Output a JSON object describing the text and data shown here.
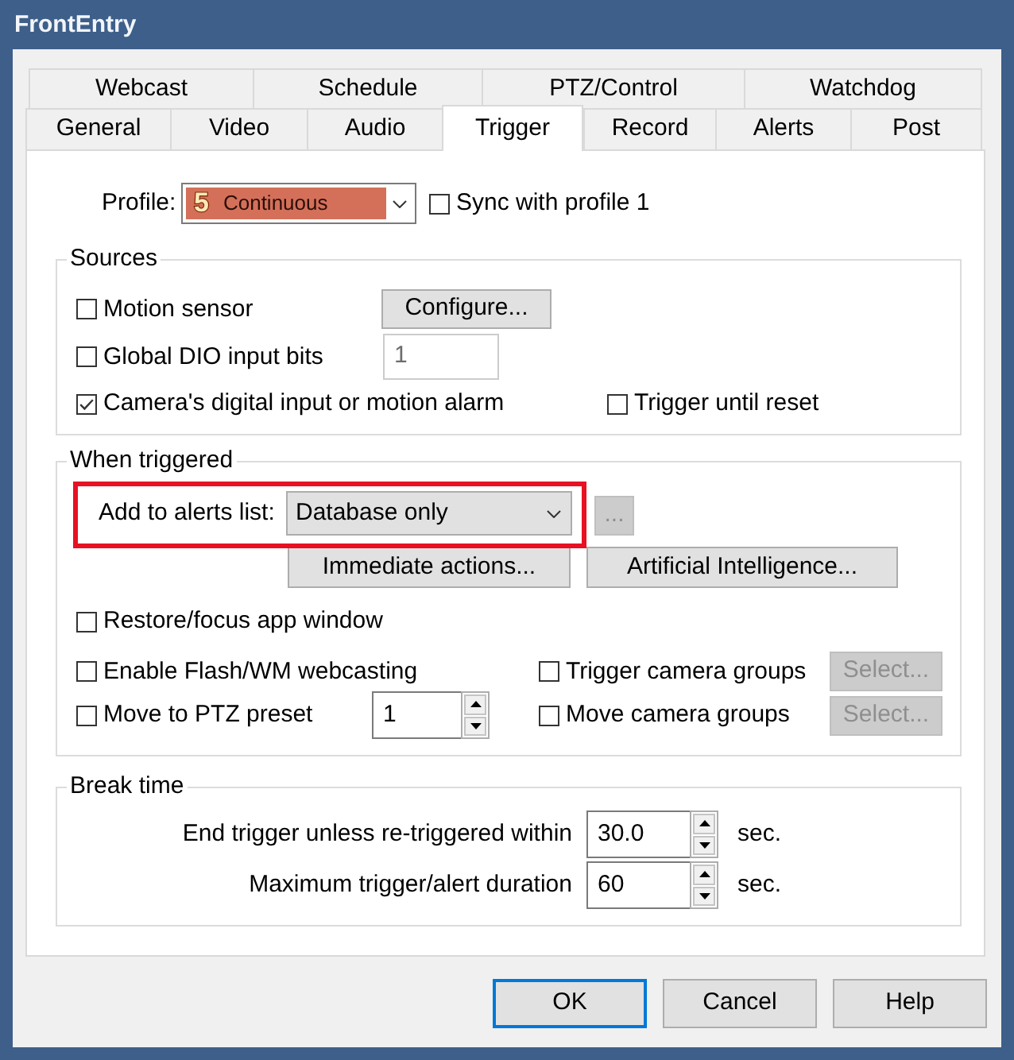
{
  "window": {
    "title": "FrontEntry"
  },
  "tab_rows": [
    [
      {
        "label": "Webcast",
        "selected": false
      },
      {
        "label": "Schedule",
        "selected": false
      },
      {
        "label": "PTZ/Control",
        "selected": false
      },
      {
        "label": "Watchdog",
        "selected": false
      }
    ],
    [
      {
        "label": "General",
        "selected": false
      },
      {
        "label": "Video",
        "selected": false
      },
      {
        "label": "Audio",
        "selected": false
      },
      {
        "label": "Trigger",
        "selected": true
      },
      {
        "label": "Record",
        "selected": false
      },
      {
        "label": "Alerts",
        "selected": false
      },
      {
        "label": "Post",
        "selected": false
      }
    ]
  ],
  "profile": {
    "label": "Profile:",
    "number": "5",
    "value": "Continuous",
    "sync": {
      "label": "Sync with profile 1",
      "checked": false
    }
  },
  "sources": {
    "title": "Sources",
    "motion_sensor": {
      "label": "Motion sensor",
      "checked": false,
      "button": {
        "label": "Configure...",
        "disabled": false
      }
    },
    "dio_bits": {
      "label": "Global DIO input bits",
      "checked": false,
      "value": "1",
      "disabled": true
    },
    "camera_input": {
      "label": "Camera's digital input or motion alarm",
      "checked": true
    },
    "trigger_until_reset": {
      "label": "Trigger until reset",
      "checked": false
    }
  },
  "when_triggered": {
    "title": "When triggered",
    "alerts_list": {
      "label": "Add to alerts list:",
      "value": "Database only",
      "highlighted": true,
      "more_button": {
        "label": "...",
        "disabled": true
      }
    },
    "action_buttons": [
      {
        "label": "Immediate actions...",
        "disabled": false
      },
      {
        "label": "Artificial Intelligence...",
        "disabled": false
      }
    ],
    "restore_focus": {
      "label": "Restore/focus app window",
      "checked": false
    },
    "webcasting": {
      "label": "Enable Flash/WM webcasting",
      "checked": false
    },
    "ptz_preset": {
      "label": "Move to PTZ preset",
      "checked": false,
      "value": "1"
    },
    "trigger_groups": {
      "label": "Trigger camera groups",
      "checked": false,
      "button": {
        "label": "Select...",
        "disabled": true
      }
    },
    "move_groups": {
      "label": "Move camera groups",
      "checked": false,
      "button": {
        "label": "Select...",
        "disabled": true
      }
    }
  },
  "break_time": {
    "title": "Break time",
    "rows": [
      {
        "label": "End trigger unless re-triggered within",
        "value": "30.0",
        "unit": "sec."
      },
      {
        "label": "Maximum trigger/alert duration",
        "value": "60",
        "unit": "sec."
      }
    ]
  },
  "buttons": [
    {
      "label": "OK",
      "default": true
    },
    {
      "label": "Cancel",
      "default": false
    },
    {
      "label": "Help",
      "default": false
    }
  ]
}
